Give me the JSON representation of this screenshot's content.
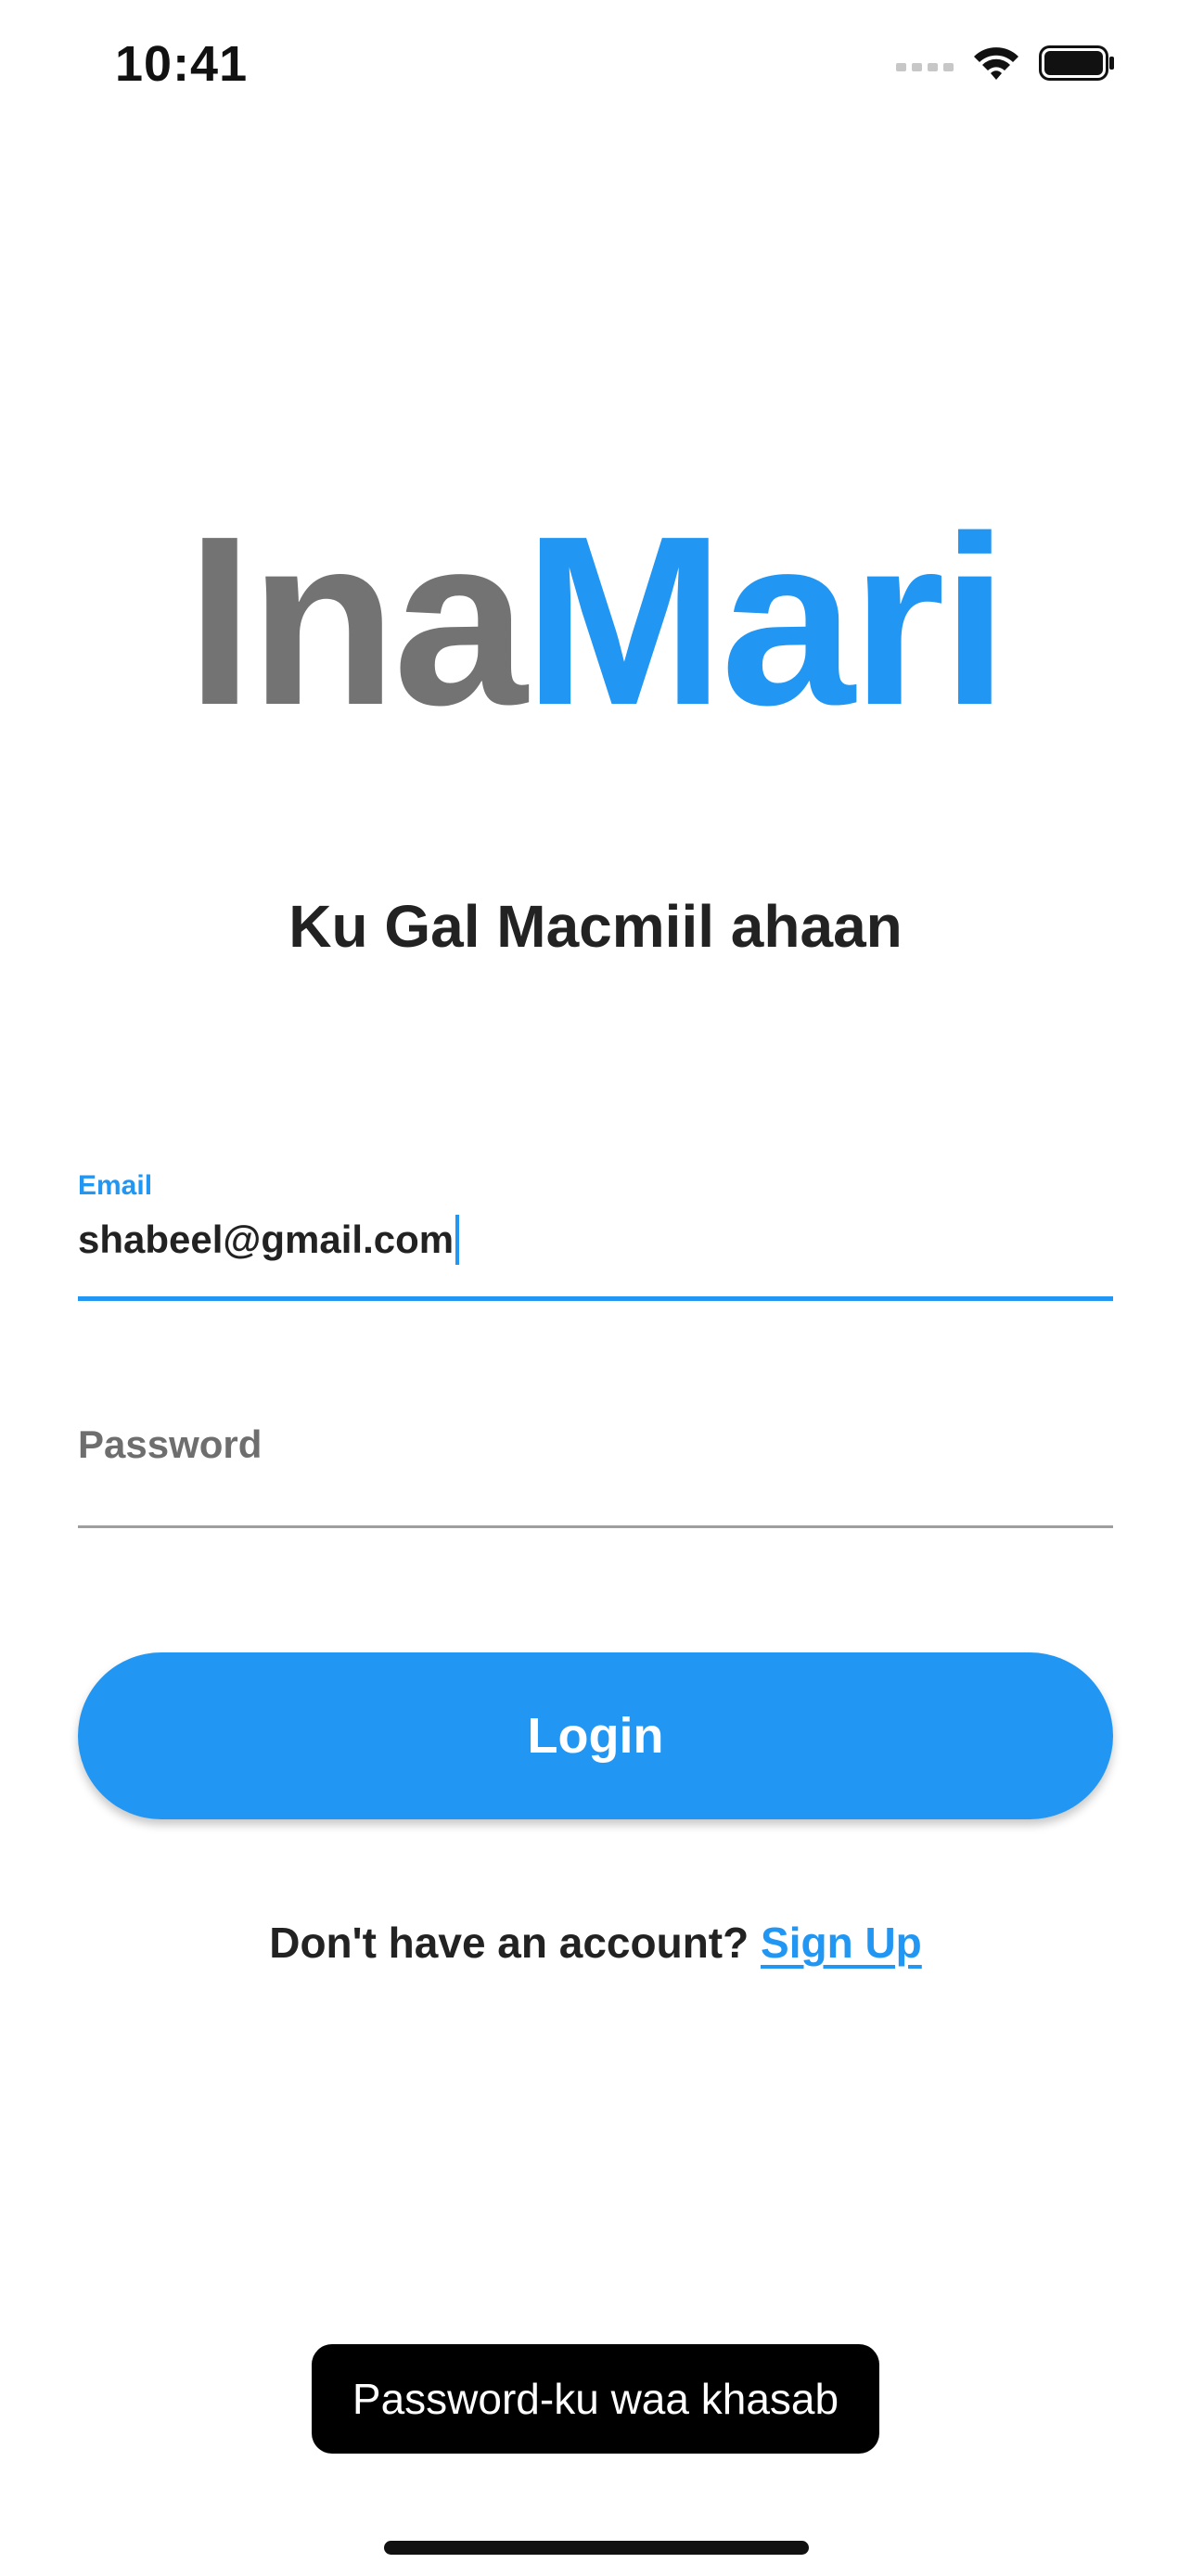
{
  "status_bar": {
    "time": "10:41",
    "icons": [
      "signal-icon",
      "wifi-icon",
      "battery-icon"
    ]
  },
  "logo": {
    "part1": "Ina",
    "part2": "Mari"
  },
  "subtitle": "Ku Gal Macmiil ahaan",
  "email_field": {
    "label": "Email",
    "value": "shabeel@gmail.com"
  },
  "password_field": {
    "placeholder": "Password"
  },
  "login_button": {
    "label": "Login"
  },
  "signup": {
    "prompt": "Don't have an account?",
    "link": "Sign Up"
  },
  "toast": {
    "message": "Password-ku waa khasab"
  },
  "colors": {
    "accent": "#2196f3",
    "logo_gray": "#737373",
    "toast_bg": "#000000"
  }
}
